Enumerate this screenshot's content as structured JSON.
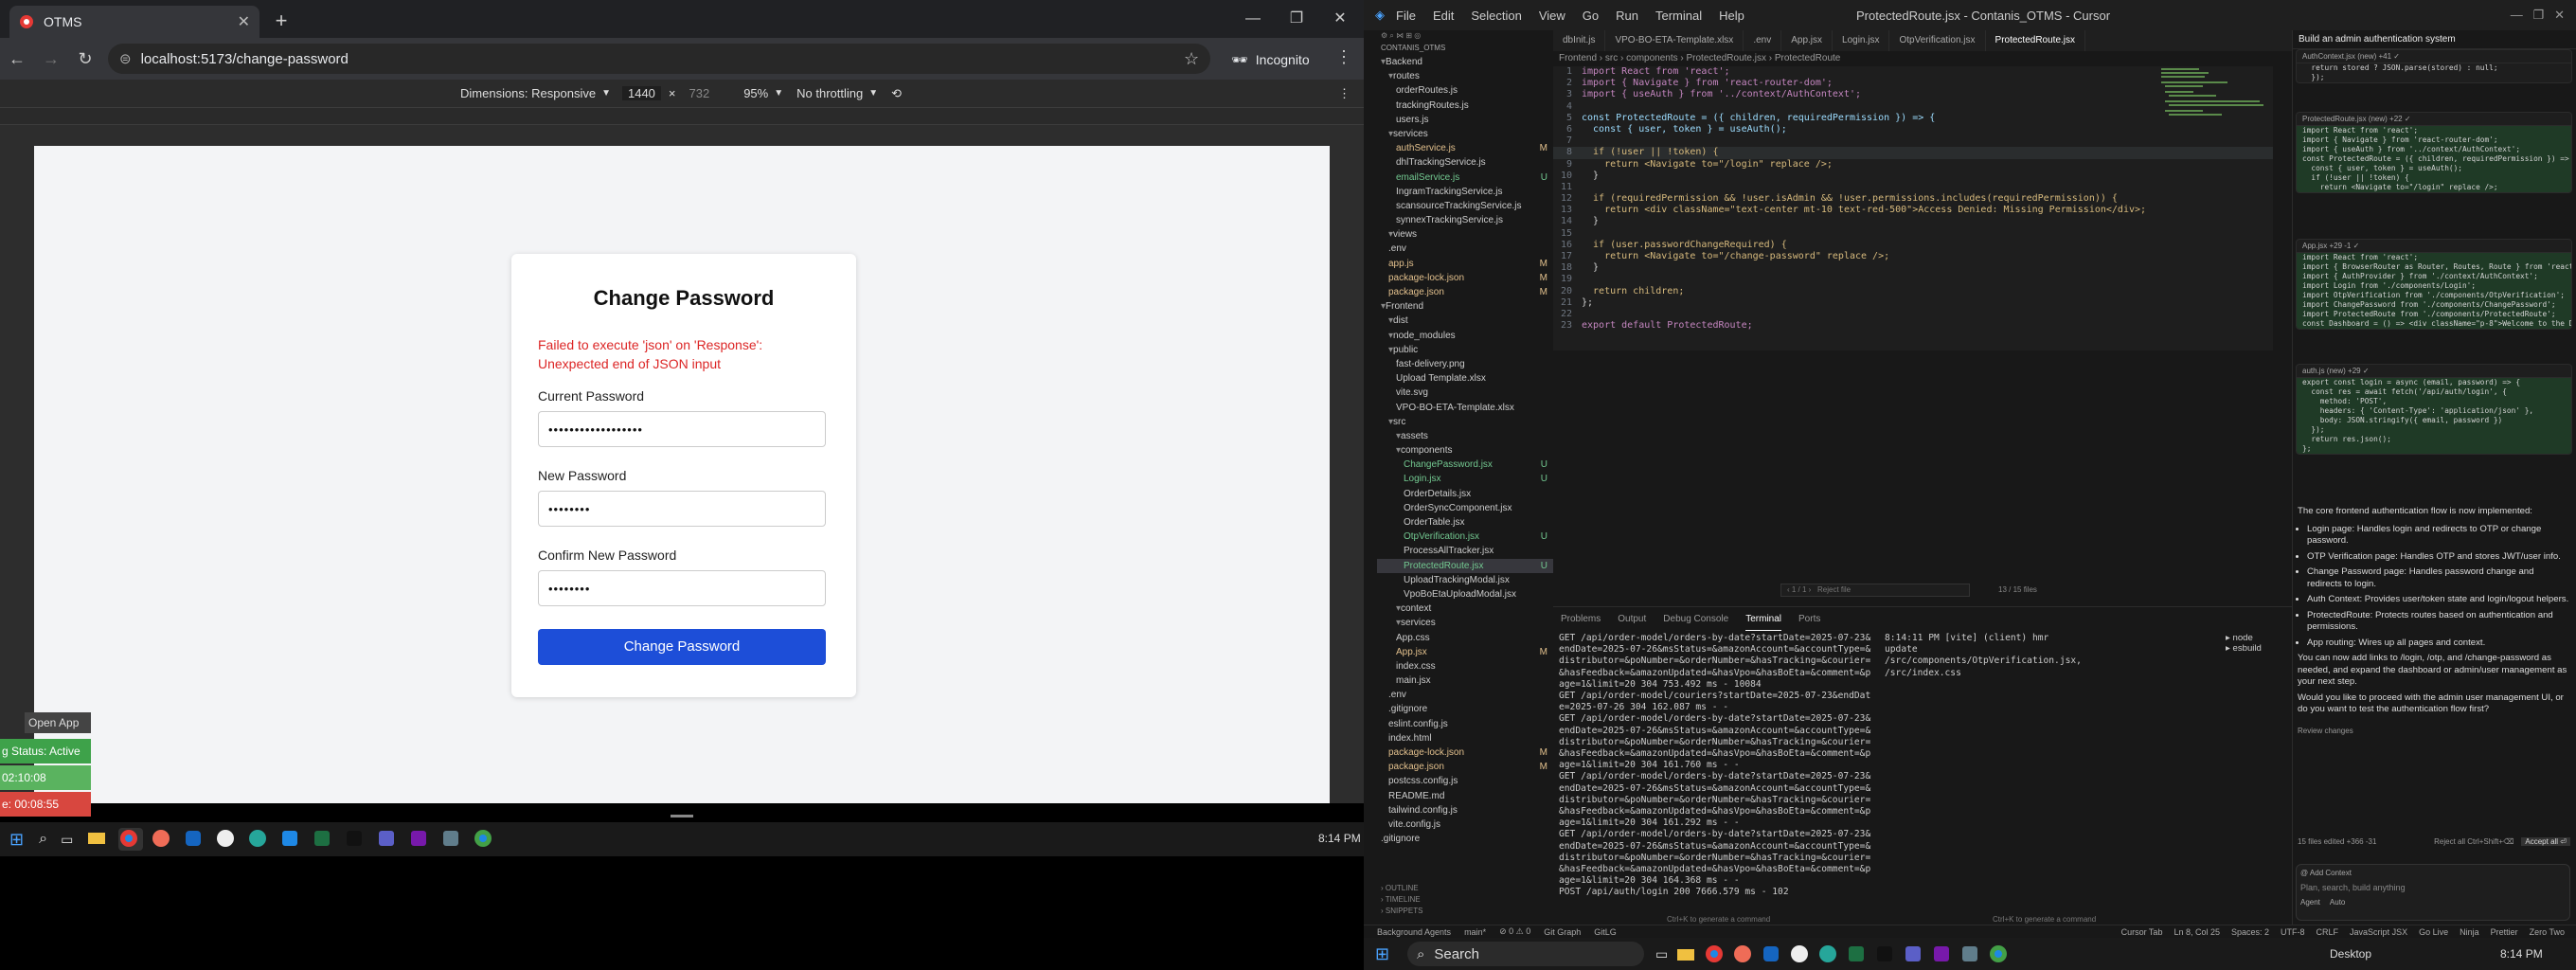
{
  "browser": {
    "tab_title": "OTMS",
    "url": "localhost:5173/change-password",
    "profile_label": "Incognito",
    "devtools": {
      "dimensions_label": "Dimensions: Responsive",
      "width": "1440",
      "x": "×",
      "height": "732",
      "zoom": "95%",
      "throttle": "No throttling"
    }
  },
  "form": {
    "title": "Change Password",
    "error": "Failed to execute 'json' on 'Response': Unexpected end of JSON input",
    "current_label": "Current Password",
    "current_value": "••••••••••••••••••",
    "new_label": "New Password",
    "new_value": "••••••••",
    "confirm_label": "Confirm New Password",
    "confirm_value": "••••••••",
    "submit_label": "Change Password"
  },
  "overlay": {
    "open_app": "Open App ↗",
    "status": "g Status: Active",
    "time1": "02:10:08",
    "time2": "e: 00:08:55"
  },
  "taskbar_left": {
    "clock": "8:14 PM"
  },
  "cursor": {
    "title": "ProtectedRoute.jsx - Contanis_OTMS - Cursor",
    "menu": [
      "File",
      "Edit",
      "Selection",
      "View",
      "Go",
      "Run",
      "Terminal",
      "Help"
    ],
    "explorer_header": "CONTANIS_OTMS",
    "tree": [
      {
        "name": "Backend",
        "indent": 0,
        "badge": ""
      },
      {
        "name": "routes",
        "indent": 1,
        "badge": ""
      },
      {
        "name": "orderRoutes.js",
        "indent": 2,
        "badge": ""
      },
      {
        "name": "trackingRoutes.js",
        "indent": 2,
        "badge": ""
      },
      {
        "name": "users.js",
        "indent": 2,
        "badge": ""
      },
      {
        "name": "services",
        "indent": 1,
        "badge": ""
      },
      {
        "name": "authService.js",
        "indent": 2,
        "badge": "M"
      },
      {
        "name": "dhlTrackingService.js",
        "indent": 2,
        "badge": ""
      },
      {
        "name": "emailService.js",
        "indent": 2,
        "badge": "U"
      },
      {
        "name": "IngramTrackingService.js",
        "indent": 2,
        "badge": ""
      },
      {
        "name": "scansourceTrackingService.js",
        "indent": 2,
        "badge": ""
      },
      {
        "name": "synnexTrackingService.js",
        "indent": 2,
        "badge": ""
      },
      {
        "name": "views",
        "indent": 1,
        "badge": ""
      },
      {
        "name": ".env",
        "indent": 1,
        "badge": ""
      },
      {
        "name": "app.js",
        "indent": 1,
        "badge": "M"
      },
      {
        "name": "package-lock.json",
        "indent": 1,
        "badge": "M"
      },
      {
        "name": "package.json",
        "indent": 1,
        "badge": "M"
      },
      {
        "name": "Frontend",
        "indent": 0,
        "badge": ""
      },
      {
        "name": "dist",
        "indent": 1,
        "badge": ""
      },
      {
        "name": "node_modules",
        "indent": 1,
        "badge": ""
      },
      {
        "name": "public",
        "indent": 1,
        "badge": ""
      },
      {
        "name": "fast-delivery.png",
        "indent": 2,
        "badge": ""
      },
      {
        "name": "Upload Template.xlsx",
        "indent": 2,
        "badge": ""
      },
      {
        "name": "vite.svg",
        "indent": 2,
        "badge": ""
      },
      {
        "name": "VPO-BO-ETA-Template.xlsx",
        "indent": 2,
        "badge": ""
      },
      {
        "name": "src",
        "indent": 1,
        "badge": ""
      },
      {
        "name": "assets",
        "indent": 2,
        "badge": ""
      },
      {
        "name": "components",
        "indent": 2,
        "badge": ""
      },
      {
        "name": "ChangePassword.jsx",
        "indent": 3,
        "badge": "U"
      },
      {
        "name": "Login.jsx",
        "indent": 3,
        "badge": "U"
      },
      {
        "name": "OrderDetails.jsx",
        "indent": 3,
        "badge": ""
      },
      {
        "name": "OrderSyncComponent.jsx",
        "indent": 3,
        "badge": ""
      },
      {
        "name": "OrderTable.jsx",
        "indent": 3,
        "badge": ""
      },
      {
        "name": "OtpVerification.jsx",
        "indent": 3,
        "badge": "U"
      },
      {
        "name": "ProcessAllTracker.jsx",
        "indent": 3,
        "badge": ""
      },
      {
        "name": "ProtectedRoute.jsx",
        "indent": 3,
        "badge": "U"
      },
      {
        "name": "UploadTrackingModal.jsx",
        "indent": 3,
        "badge": ""
      },
      {
        "name": "VpoBoEtaUploadModal.jsx",
        "indent": 3,
        "badge": ""
      },
      {
        "name": "context",
        "indent": 2,
        "badge": ""
      },
      {
        "name": "services",
        "indent": 2,
        "badge": ""
      },
      {
        "name": "App.css",
        "indent": 2,
        "badge": ""
      },
      {
        "name": "App.jsx",
        "indent": 2,
        "badge": "M"
      },
      {
        "name": "index.css",
        "indent": 2,
        "badge": ""
      },
      {
        "name": "main.jsx",
        "indent": 2,
        "badge": ""
      },
      {
        "name": ".env",
        "indent": 1,
        "badge": ""
      },
      {
        "name": ".gitignore",
        "indent": 1,
        "badge": ""
      },
      {
        "name": "eslint.config.js",
        "indent": 1,
        "badge": ""
      },
      {
        "name": "index.html",
        "indent": 1,
        "badge": ""
      },
      {
        "name": "package-lock.json",
        "indent": 1,
        "badge": "M"
      },
      {
        "name": "package.json",
        "indent": 1,
        "badge": "M"
      },
      {
        "name": "postcss.config.js",
        "indent": 1,
        "badge": ""
      },
      {
        "name": "README.md",
        "indent": 1,
        "badge": ""
      },
      {
        "name": "tailwind.config.js",
        "indent": 1,
        "badge": ""
      },
      {
        "name": "vite.config.js",
        "indent": 1,
        "badge": ""
      },
      {
        "name": ".gitignore",
        "indent": 0,
        "badge": ""
      }
    ],
    "outline": [
      "OUTLINE",
      "TIMELINE",
      "SNIPPETS"
    ],
    "editor_tabs": [
      "dbInit.js",
      "VPO-BO-ETA-Template.xlsx",
      ".env",
      "App.jsx",
      "Login.jsx",
      "OtpVerification.jsx",
      "ProtectedRoute.jsx"
    ],
    "breadcrumb": "Frontend › src › components › ProtectedRoute.jsx › ProtectedRoute",
    "code_lines": [
      "import React from 'react';",
      "import { Navigate } from 'react-router-dom';",
      "import { useAuth } from '../context/AuthContext';",
      "",
      "const ProtectedRoute = ({ children, requiredPermission }) => {",
      "  const { user, token } = useAuth();",
      "",
      "  if (!user || !token) {",
      "    return <Navigate to=\"/login\" replace />;",
      "  }",
      "",
      "  if (requiredPermission && !user.isAdmin && !user.permissions.includes(requiredPermission)) {",
      "    return <div className=\"text-center mt-10 text-red-500\">Access Denied: Missing Permission</div>;",
      "  }",
      "",
      "  if (user.passwordChangeRequired) {",
      "    return <Navigate to=\"/change-password\" replace />;",
      "  }",
      "",
      "  return children;",
      "};",
      "",
      "export default ProtectedRoute;"
    ],
    "panel_tabs": [
      "Problems",
      "Output",
      "Debug Console",
      "Terminal",
      "Ports"
    ],
    "terminal_left": "GET /api/order-model/orders-by-date?startDate=2025-07-23&endDate=2025-07-26&msStatus=&amazonAccount=&accountType=&distributor=&poNumber=&orderNumber=&hasTracking=&courier=&hasFeedback=&amazonUpdated=&hasVpo=&hasBoEta=&comment=&page=1&limit=20 304 753.492 ms - 10084\nGET /api/order-model/couriers?startDate=2025-07-23&endDate=2025-07-26 304 162.087 ms - -\nGET /api/order-model/orders-by-date?startDate=2025-07-23&endDate=2025-07-26&msStatus=&amazonAccount=&accountType=&distributor=&poNumber=&orderNumber=&hasTracking=&courier=&hasFeedback=&amazonUpdated=&hasVpo=&hasBoEta=&comment=&page=1&limit=20 304 161.760 ms - -\nGET /api/order-model/orders-by-date?startDate=2025-07-23&endDate=2025-07-26&msStatus=&amazonAccount=&accountType=&distributor=&poNumber=&orderNumber=&hasTracking=&courier=&hasFeedback=&amazonUpdated=&hasVpo=&hasBoEta=&comment=&page=1&limit=20 304 161.292 ms - -\nGET /api/order-model/orders-by-date?startDate=2025-07-23&endDate=2025-07-26&msStatus=&amazonAccount=&accountType=&distributor=&poNumber=&orderNumber=&hasTracking=&courier=&hasFeedback=&amazonUpdated=&hasVpo=&hasBoEta=&comment=&page=1&limit=20 304 164.368 ms - -\nPOST /api/auth/login 200 7666.579 ms - 102",
    "terminal_right": "8:14:11 PM [vite] (client) hmr update /src/components/OtpVerification.jsx, /src/index.css",
    "term_list": [
      "node",
      "esbuild"
    ],
    "cmd_hint_left": "Ctrl+K to generate a command",
    "cmd_hint_right": "Ctrl+K to generate a command",
    "status_items": [
      "Background Agents",
      "main*",
      "⊘ 0 ⚠ 0",
      "Git Graph",
      "GitLG"
    ],
    "status_right": [
      "Cursor Tab",
      "Ln 8, Col 25",
      "Spaces: 2",
      "UTF-8",
      "CRLF",
      "JavaScript JSX",
      "Go Live",
      "Ninja",
      "Prettier",
      "Zero Two"
    ]
  },
  "chat": {
    "title": "Build an admin authentication system",
    "blocks": [
      {
        "header": "AuthContext.jsx (new) +41 ✓",
        "lines": [
          "  return stored ? JSON.parse(stored) : null;",
          "  });",
          ""
        ],
        "added": [
          false,
          false,
          false
        ]
      },
      {
        "header": "ProtectedRoute.jsx (new) +22 ✓",
        "lines": [
          "import React from 'react';",
          "import { Navigate } from 'react-router-dom';",
          "import { useAuth } from '../context/AuthContext';",
          "",
          "const ProtectedRoute = ({ children, requiredPermission }) =>",
          "  const { user, token } = useAuth();",
          "",
          "  if (!user || !token) {",
          "    return <Navigate to=\"/login\" replace />;"
        ],
        "added": [
          true,
          true,
          true,
          true,
          true,
          true,
          true,
          true,
          true
        ]
      },
      {
        "header": "App.jsx +29 -1 ✓",
        "lines": [
          "import React from 'react';",
          "import { BrowserRouter as Router, Routes, Route } from 'react",
          "import { AuthProvider } from './context/AuthContext';",
          "import Login from './components/Login';",
          "import OtpVerification from './components/OtpVerification';",
          "import ChangePassword from './components/ChangePassword';",
          "import ProtectedRoute from './components/ProtectedRoute';",
          "",
          "const Dashboard = () => <div className=\"p-8\">Welcome to the D"
        ],
        "added": [
          true,
          true,
          true,
          true,
          true,
          true,
          true,
          true,
          true
        ]
      },
      {
        "header": "auth.js (new) +29 ✓",
        "lines": [
          "export const login = async (email, password) => {",
          "  const res = await fetch('/api/auth/login', {",
          "    method: 'POST',",
          "    headers: { 'Content-Type': 'application/json' },",
          "    body: JSON.stringify({ email, password })",
          "  });",
          "  return res.json();",
          "};"
        ],
        "added": [
          true,
          true,
          true,
          true,
          true,
          true,
          true,
          true
        ]
      }
    ],
    "summary_intro": "The core frontend authentication flow is now implemented:",
    "bullets": [
      "Login page: Handles login and redirects to OTP or change password.",
      "OTP Verification page: Handles OTP and stores JWT/user info.",
      "Change Password page: Handles password change and redirects to login.",
      "Auth Context: Provides user/token state and login/logout helpers.",
      "ProtectedRoute: Protects routes based on authentication and permissions.",
      "App routing: Wires up all pages and context."
    ],
    "followup": "You can now add links to /login, /otp, and /change-password as needed, and expand the dashboard or admin/user management as your next step.",
    "question": "Would you like to proceed with the admin user management UI, or do you want to test the authentication flow first?",
    "review": "Review changes",
    "files_summary": "15 files edited +366 -31",
    "reject_all": "Reject all Ctrl+Shift+⌫",
    "accept_all": "Accept all ⏎",
    "input_placeholder": "Plan, search, build anything",
    "agent_mode": "Agent",
    "model": "Auto"
  },
  "taskbar_right": {
    "search": "Search",
    "desktop": "Desktop",
    "clock": "8:14 PM"
  },
  "colors": {
    "primary_button": "#1d4ed8",
    "error": "#dc2626",
    "status_active": "#3ea24a",
    "status_bad": "#d8473f"
  }
}
